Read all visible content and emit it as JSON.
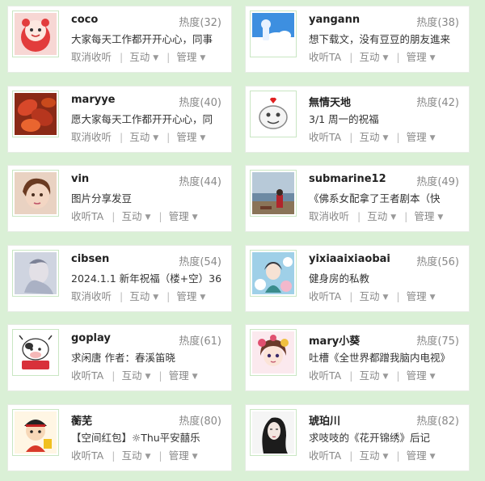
{
  "labels": {
    "heat_label": "热度",
    "interact": "互动",
    "manage": "管理"
  },
  "cards": [
    {
      "name": "coco",
      "heat": "(32)",
      "desc": "大家每天工作都开开心心，同事",
      "follow": "取消收听",
      "avatar": "cartoon-red-face"
    },
    {
      "name": "yangann",
      "heat": "(38)",
      "desc": "想下载文，没有豆豆的朋友進来",
      "follow": "收听TA",
      "avatar": "blue-cloud"
    },
    {
      "name": "maryye",
      "heat": "(40)",
      "desc": "愿大家每天工作都开开心心，同",
      "follow": "取消收听",
      "avatar": "red-leaves"
    },
    {
      "name": "無情天地",
      "heat": "(42)",
      "desc": "3/1 周一的祝福",
      "follow": "收听TA",
      "avatar": "smiley-doodle"
    },
    {
      "name": "vin",
      "heat": "(44)",
      "desc": "图片分享发豆",
      "follow": "收听TA",
      "avatar": "child-photo"
    },
    {
      "name": "submarine12",
      "heat": "(49)",
      "desc": "《佛系女配拿了王者剧本（快",
      "follow": "取消收听",
      "avatar": "seaside-person"
    },
    {
      "name": "cibsen",
      "heat": "(54)",
      "desc": "2024.1.1 新年祝福（楼+空）36",
      "follow": "取消收听",
      "avatar": "blurry-portrait"
    },
    {
      "name": "yixiaaixiaobai",
      "heat": "(56)",
      "desc": "健身房的私教",
      "follow": "收听TA",
      "avatar": "flower-girl"
    },
    {
      "name": "goplay",
      "heat": "(61)",
      "desc": "求闲唐 作者：春溪笛晓",
      "follow": "收听TA",
      "avatar": "cartoon-cow"
    },
    {
      "name": "mary小葵",
      "heat": "(75)",
      "desc": "吐槽《全世界都蹭我脑内电视》",
      "follow": "收听TA",
      "avatar": "anime-girl-flowers"
    },
    {
      "name": "蘅芜",
      "heat": "(80)",
      "desc": "【空间红包】☼Thu平安囍乐",
      "follow": "收听TA",
      "avatar": "cartoon-boy-hat"
    },
    {
      "name": "琥珀川",
      "heat": "(82)",
      "desc": "求吱吱的《花开锦绣》后记",
      "follow": "收听TA",
      "avatar": "ink-portrait"
    }
  ]
}
